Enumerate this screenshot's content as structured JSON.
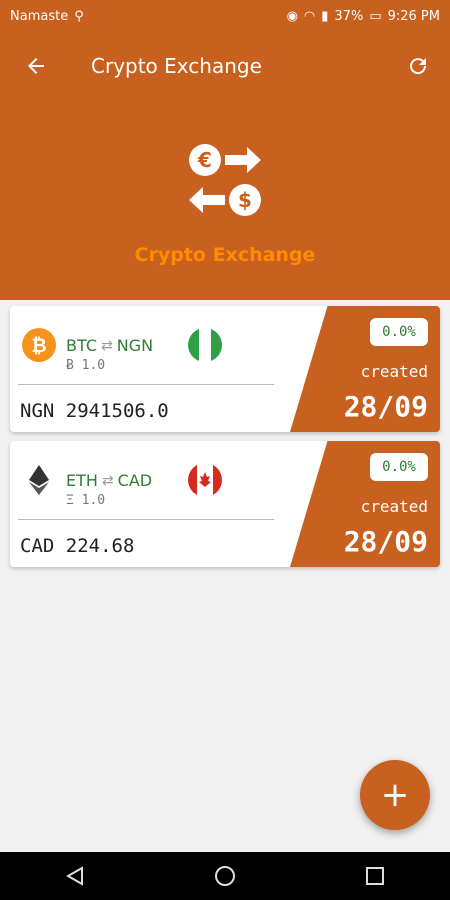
{
  "status_bar": {
    "carrier": "Namaste",
    "battery": "37%",
    "time": "9:26 PM"
  },
  "app_bar": {
    "title": "Crypto Exchange",
    "back_icon": "arrow-left-icon",
    "refresh_icon": "refresh-icon"
  },
  "header": {
    "title": "Crypto Exchange",
    "icon": "currency-exchange-icon"
  },
  "cards": [
    {
      "from": "BTC",
      "to": "NGN",
      "amount": "Ƀ 1.0",
      "converted": "NGN 2941506.0",
      "percent": "0.0%",
      "created_label": "created",
      "date": "28/09",
      "coin_icon": "bitcoin-icon",
      "flag_icon": "nigeria-flag-icon"
    },
    {
      "from": "ETH",
      "to": "CAD",
      "amount": "Ξ 1.0",
      "converted": "CAD 224.68",
      "percent": "0.0%",
      "created_label": "created",
      "date": "28/09",
      "coin_icon": "ethereum-icon",
      "flag_icon": "canada-flag-icon"
    }
  ],
  "fab": {
    "label": "+"
  },
  "colors": {
    "primary": "#c8601f",
    "accent": "#ff8a00",
    "pair_text": "#2e7d32"
  }
}
